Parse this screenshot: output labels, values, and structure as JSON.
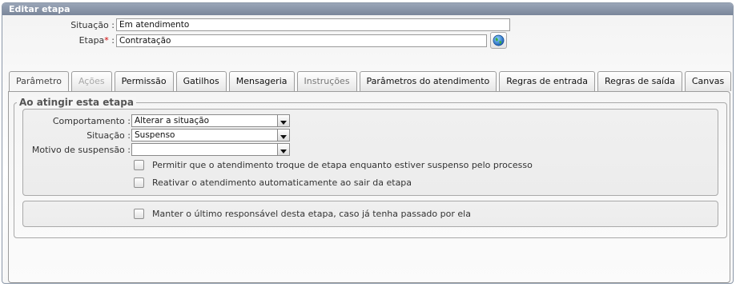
{
  "window": {
    "title": "Editar etapa"
  },
  "form": {
    "situacao_label": "Situação :",
    "situacao_value": "Em atendimento",
    "etapa_label": "Etapa",
    "etapa_required": "*",
    "etapa_colon": " :",
    "etapa_value": "Contratação"
  },
  "tabs": [
    {
      "label": "Parâmetro",
      "state": "active"
    },
    {
      "label": "Ações",
      "state": "disabled"
    },
    {
      "label": "Permissão",
      "state": "normal"
    },
    {
      "label": "Gatilhos",
      "state": "normal"
    },
    {
      "label": "Mensageria",
      "state": "normal"
    },
    {
      "label": "Instruções",
      "state": "normal"
    },
    {
      "label": "Parâmetros do atendimento",
      "state": "normal"
    },
    {
      "label": "Regras de entrada",
      "state": "normal"
    },
    {
      "label": "Regras de saída",
      "state": "normal"
    },
    {
      "label": "Canvas",
      "state": "normal"
    }
  ],
  "section": {
    "title": "Ao atingir esta etapa",
    "comportamento_label": "Comportamento :",
    "comportamento_value": "Alterar a situação",
    "situacao_label": "Situação :",
    "situacao_value": "Suspenso",
    "motivo_label": "Motivo de suspensão :",
    "motivo_value": "",
    "check_permitir": "Permitir que o atendimento troque de etapa enquanto estiver suspenso pelo processo",
    "check_reativar": "Reativar o atendimento automaticamente ao sair da etapa"
  },
  "bottom": {
    "check_manter": "Manter o último responsável desta etapa, caso já tenha passado por ela"
  },
  "icons": {
    "globe": "globe-icon",
    "dropdown": "chevron-down-icon"
  },
  "colors": {
    "titlebar": "#8591a4",
    "required": "#d00000"
  }
}
